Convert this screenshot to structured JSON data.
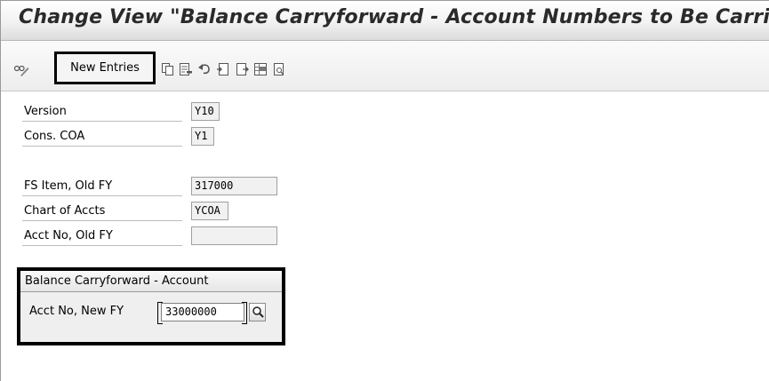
{
  "header": {
    "title": "Change View \"Balance Carryforward - Account Numbers to Be Carried Forw"
  },
  "toolbar": {
    "new_entries_label": "New Entries",
    "icons": [
      "glasses-pencil-icon",
      "copy-icon",
      "delete-icon",
      "undo-icon",
      "select-all-icon",
      "deselect-icon",
      "select-block-icon",
      "print-icon"
    ]
  },
  "fields": {
    "version": {
      "label": "Version",
      "value": "Y10"
    },
    "cons_coa": {
      "label": "Cons. COA",
      "value": "Y1"
    },
    "fs_item": {
      "label": "FS Item, Old FY",
      "value": "317000"
    },
    "chart_accts": {
      "label": "Chart of Accts",
      "value": "YCOA"
    },
    "acct_old": {
      "label": "Acct No, Old FY",
      "value": ""
    }
  },
  "balance_group": {
    "title": "Balance Carryforward - Account",
    "acct_new_label": "Acct No, New FY",
    "acct_new_value": "33000000"
  }
}
